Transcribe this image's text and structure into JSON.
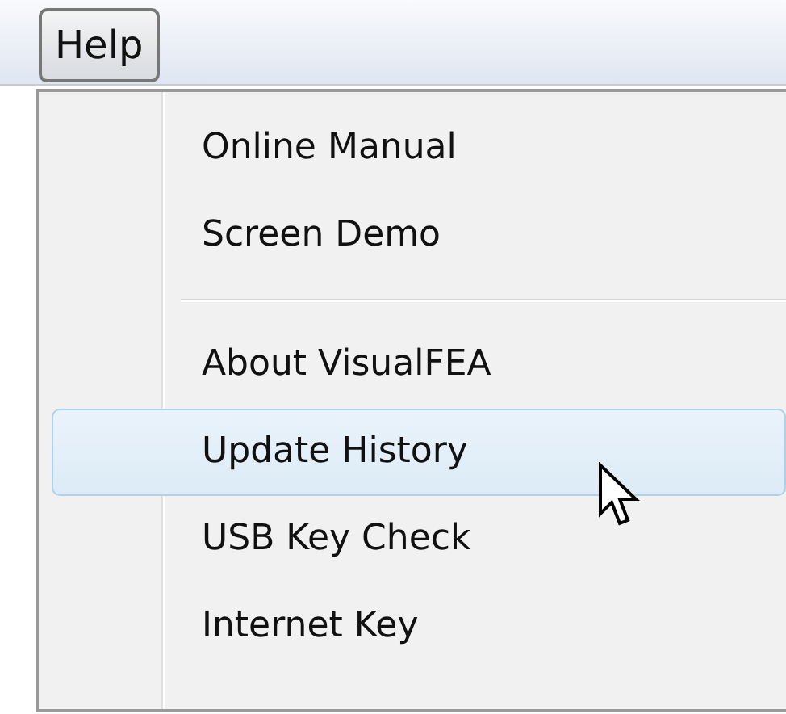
{
  "menu_bar": {
    "items": [
      {
        "label": "Help",
        "selected": true
      }
    ]
  },
  "menu": {
    "items": [
      {
        "kind": "item",
        "label": "Online Manual",
        "selected": false
      },
      {
        "kind": "item",
        "label": "Screen Demo",
        "selected": false
      },
      {
        "kind": "separator"
      },
      {
        "kind": "item",
        "label": "About VisualFEA",
        "selected": false
      },
      {
        "kind": "item",
        "label": "Update History",
        "selected": true
      },
      {
        "kind": "item",
        "label": "USB Key Check",
        "selected": false
      },
      {
        "kind": "item",
        "label": "Internet Key",
        "selected": false
      }
    ]
  }
}
